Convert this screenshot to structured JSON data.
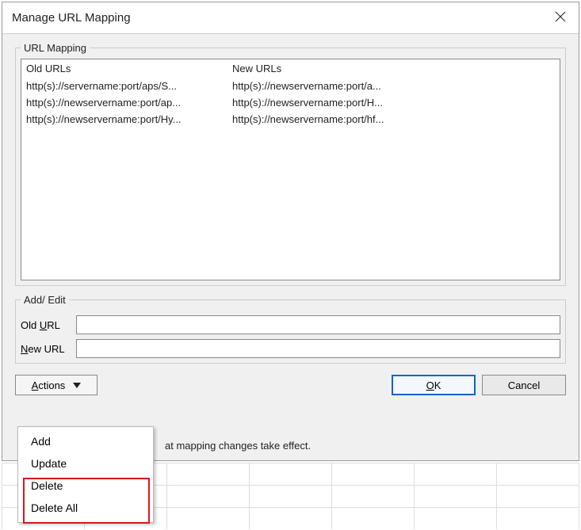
{
  "title": "Manage URL Mapping",
  "group_label": "URL Mapping",
  "columns": {
    "old": "Old URLs",
    "new": "New URLs"
  },
  "rows": [
    {
      "old": "http(s)://servername:port/aps/S...",
      "new": "http(s)://newservername:port/a..."
    },
    {
      "old": "http(s)://newservername:port/ap...",
      "new": "http(s)://newservername:port/H..."
    },
    {
      "old": "http(s)://newservername:port/Hy...",
      "new": "http(s)://newservername:port/hf..."
    }
  ],
  "addedit": {
    "legend": "Add/ Edit",
    "old_label_prefix": "Old ",
    "old_label_key": "U",
    "old_label_suffix": "RL",
    "new_label_key": "N",
    "new_label_suffix": "ew URL",
    "old_value": "",
    "new_value": ""
  },
  "actions_label_key": "A",
  "actions_label_suffix": "ctions",
  "ok_key": "O",
  "ok_suffix": "K",
  "cancel": "Cancel",
  "hint_fragment": "at mapping changes take effect.",
  "menu": {
    "add": "Add",
    "update": "Update",
    "delete": "Delete",
    "delete_all": "Delete All"
  }
}
